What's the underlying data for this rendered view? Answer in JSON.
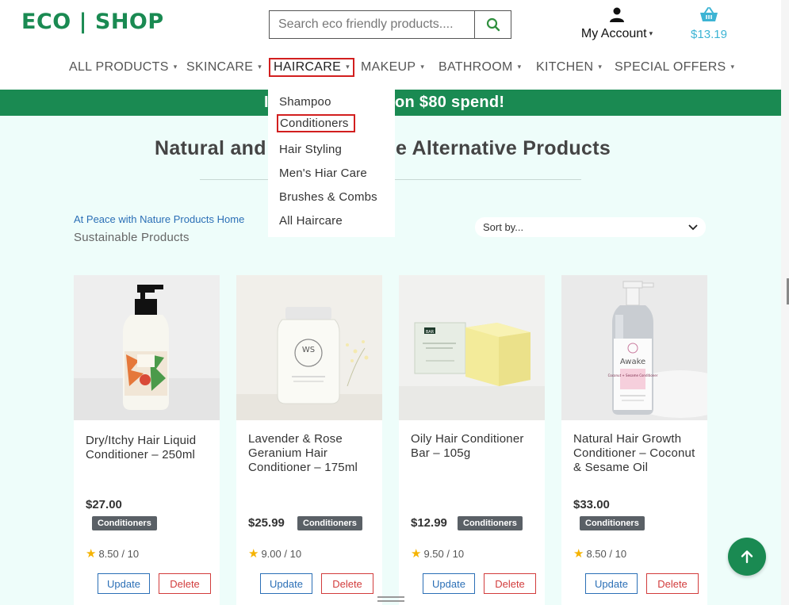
{
  "header": {
    "logo": "ECO | SHOP",
    "search_placeholder": "Search eco friendly products....",
    "account_label": "My Account",
    "cart_total": "$13.19"
  },
  "nav": {
    "items": [
      {
        "label": "ALL PRODUCTS"
      },
      {
        "label": "SKINCARE"
      },
      {
        "label": "HAIRCARE"
      },
      {
        "label": "MAKEUP"
      },
      {
        "label": "BATHROOM"
      },
      {
        "label": "KITCHEN"
      },
      {
        "label": "SPECIAL OFFERS"
      }
    ],
    "active": "HAIRCARE"
  },
  "banner": {
    "text_left": "I",
    "text_right": "on $80 spend!"
  },
  "dropdown": {
    "items": [
      "Shampoo",
      "Conditioners",
      "Hair Styling",
      "Men's Hiar Care",
      "Brushes & Combs",
      "All Haircare"
    ],
    "active": "Conditioners"
  },
  "page": {
    "heading_left": "Natural and",
    "heading_right": "e Alternative Products",
    "breadcrumb": "At Peace with Nature Products Home",
    "subcrumb": "Sustainable Products",
    "sort_label": "Sort by..."
  },
  "products": [
    {
      "title": "Dry/Itchy Hair Liquid Conditioner – 250ml",
      "price": "$27.00",
      "badge": "Conditioners",
      "rating": "8.50 / 10",
      "update": "Update",
      "delete": "Delete"
    },
    {
      "title": "Lavender & Rose Geranium Hair Conditioner – 175ml",
      "price": "$25.99",
      "badge": "Conditioners",
      "rating": "9.00 / 10",
      "update": "Update",
      "delete": "Delete"
    },
    {
      "title": "Oily Hair Conditioner Bar – 105g",
      "price": "$12.99",
      "badge": "Conditioners",
      "rating": "9.50 / 10",
      "update": "Update",
      "delete": "Delete"
    },
    {
      "title": "Natural Hair Growth Conditioner – Coconut & Sesame Oil",
      "price": "$33.00",
      "badge": "Conditioners",
      "rating": "8.50 / 10",
      "update": "Update",
      "delete": "Delete"
    }
  ],
  "product_labels": {
    "jar_brand": "WS",
    "bar_box": "BAR",
    "bottle_brand": "Awake",
    "bottle_text": "Coconut + Sesame Conditioner"
  },
  "colors": {
    "brand_green": "#1a8a52",
    "cart_blue": "#3db4d4",
    "highlight_red": "#d21f1f",
    "content_bg": "#eefdfa"
  }
}
